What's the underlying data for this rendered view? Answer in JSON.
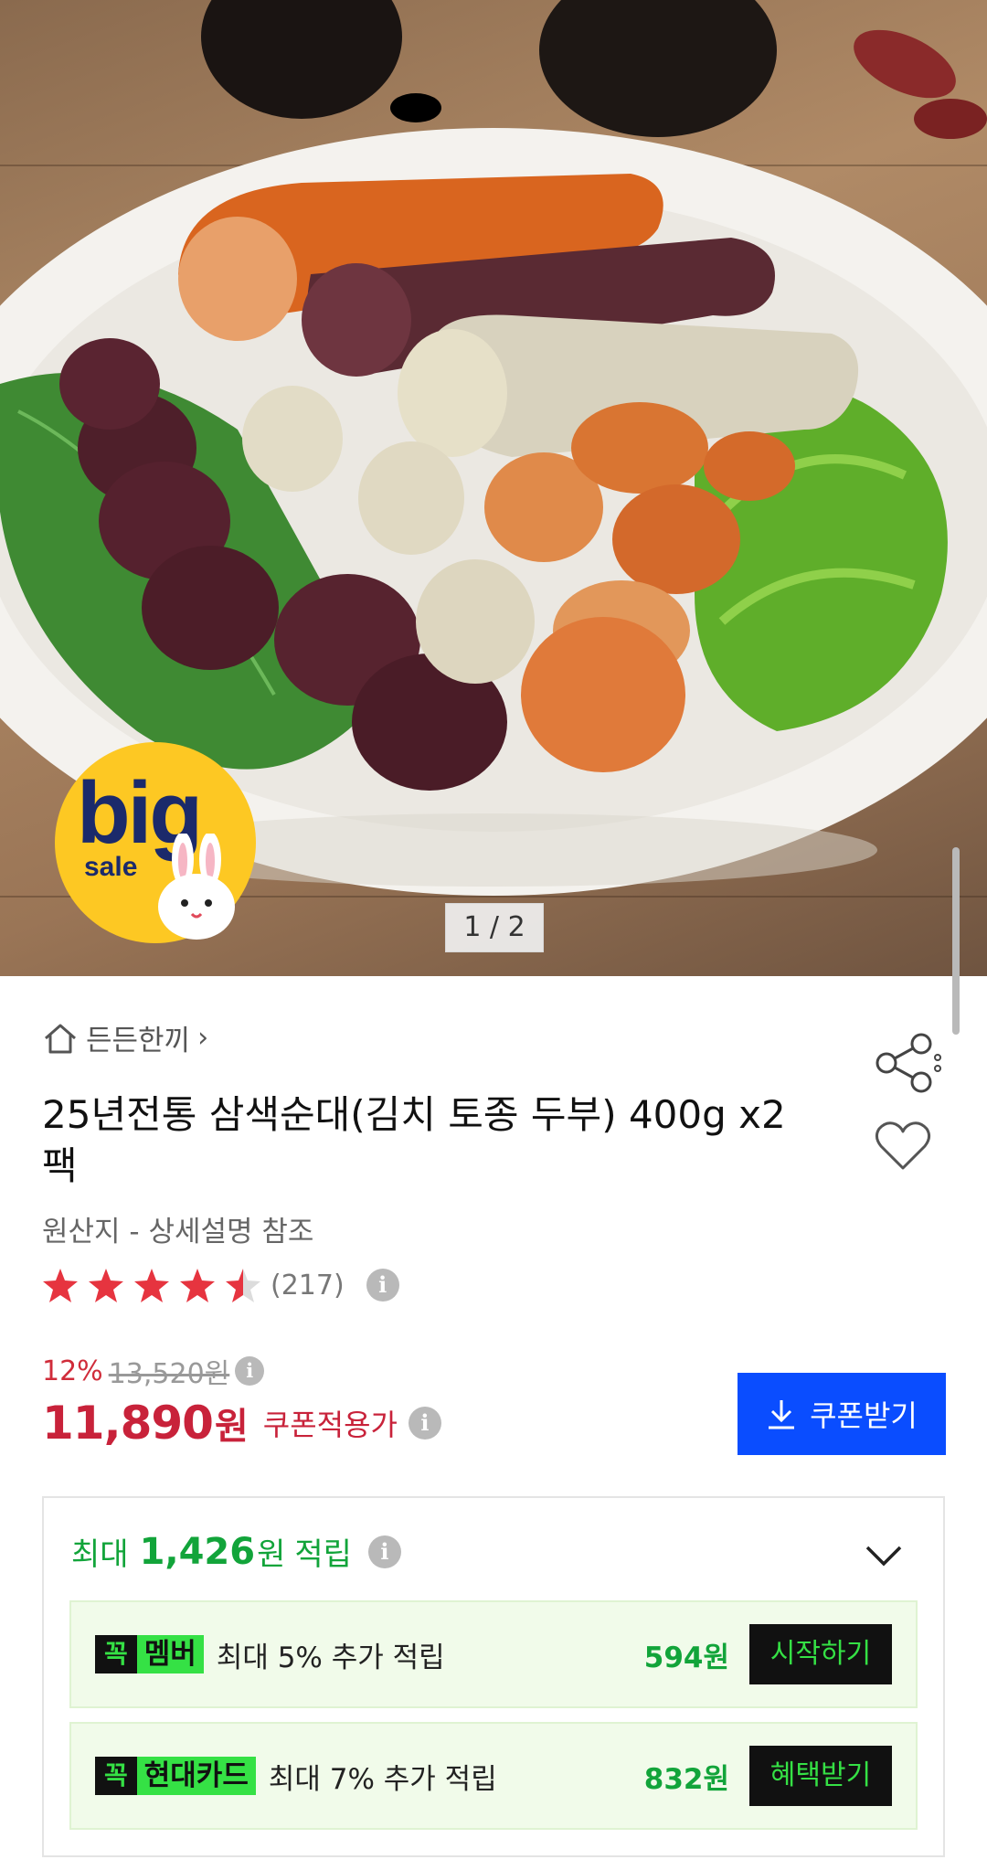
{
  "hero": {
    "counter": "1 / 2",
    "badge_text": "big",
    "badge_sub": "sale"
  },
  "category": {
    "label": "든든한끼",
    "chevron": "›"
  },
  "product": {
    "title": "25년전통 삼색순대(김치 토종 두부) 400g x2팩",
    "origin": "원산지 - 상세설명 참조",
    "rating_value": 4.5,
    "review_count": "(217)"
  },
  "price": {
    "discount_pct": "12%",
    "original": "13,520원",
    "final": "11,890",
    "final_unit": "원",
    "coupon_price_label": "쿠폰적용가"
  },
  "coupon_button": {
    "label": "쿠폰받기"
  },
  "reward": {
    "prefix": "최대",
    "amount": "1,426",
    "unit": "원",
    "suffix": "적립",
    "rows": [
      {
        "logo": "꼭",
        "tag": "멤버",
        "desc": "최대 5% 추가 적립",
        "amount": "594원",
        "action": "시작하기"
      },
      {
        "logo": "꼭",
        "tag": "현대카드",
        "desc": "최대 7% 추가 적립",
        "amount": "832원",
        "action": "혜택받기"
      }
    ]
  },
  "info_glyph": "i",
  "colors": {
    "price_red": "#c8223a",
    "coupon_blue": "#0a4dff",
    "reward_green": "#12a43a",
    "tag_green": "#35e145",
    "star_red": "#e6343f"
  },
  "icons": [
    "home-icon",
    "share-icon",
    "heart-icon",
    "star-icon",
    "info-icon",
    "download-icon",
    "chevron-down-icon"
  ]
}
